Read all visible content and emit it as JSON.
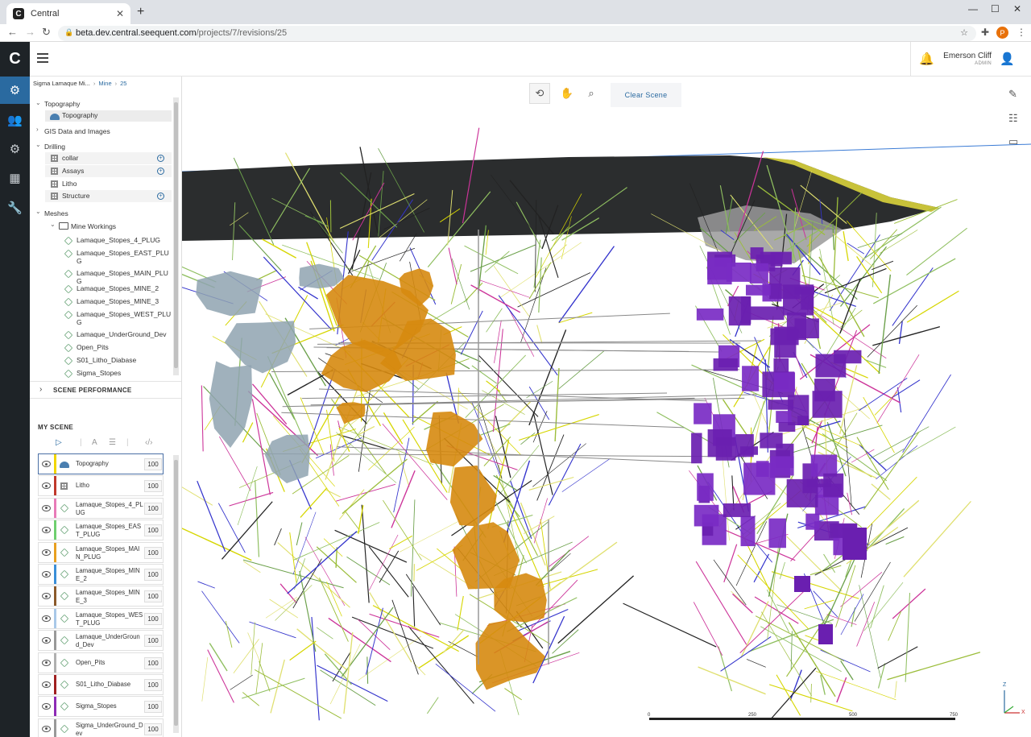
{
  "browser": {
    "tab_title": "Central",
    "url_host": "beta.dev.central.seequent.com",
    "url_path": "/projects/7/revisions/25",
    "profile_initial": "P"
  },
  "app": {
    "logo": "C",
    "user": {
      "name": "Emerson Cliff",
      "role": "ADMIN"
    },
    "rail_icons": [
      "projects-icon",
      "users-icon",
      "settings-icon",
      "calendar-icon",
      "tools-icon"
    ]
  },
  "breadcrumb": {
    "project": "Sigma Lamaque Mi...",
    "folder": "Mine",
    "revision": "25"
  },
  "tree": {
    "topography": {
      "label": "Topography",
      "child": "Topography"
    },
    "gis": {
      "label": "GIS Data and Images"
    },
    "drilling": {
      "label": "Drilling",
      "items": [
        "collar",
        "Assays",
        "Litho",
        "Structure"
      ]
    },
    "meshes": {
      "label": "Meshes",
      "folder": "Mine Workings",
      "items": [
        {
          "l1": "Lamaque_Stopes_4_PLUG",
          "l2": ""
        },
        {
          "l1": "Lamaque_Stopes_EAST_PLU",
          "l2": "G"
        },
        {
          "l1": "Lamaque_Stopes_MAIN_PLU",
          "l2": "G"
        },
        {
          "l1": "Lamaque_Stopes_MINE_2",
          "l2": ""
        },
        {
          "l1": "Lamaque_Stopes_MINE_3",
          "l2": ""
        },
        {
          "l1": "Lamaque_Stopes_WEST_PLU",
          "l2": "G"
        },
        {
          "l1": "Lamaque_UnderGround_Dev",
          "l2": ""
        },
        {
          "l1": "Open_Pits",
          "l2": ""
        },
        {
          "l1": "S01_Litho_Diabase",
          "l2": ""
        },
        {
          "l1": "Sigma_Stopes",
          "l2": ""
        }
      ]
    }
  },
  "scene_performance": {
    "label": "SCENE PERFORMANCE"
  },
  "my_scene": {
    "title": "MY SCENE",
    "items": [
      {
        "label": "Topography",
        "value": "100",
        "color": "#f2d600",
        "icon": "topography-icon"
      },
      {
        "label": "Litho",
        "value": "100",
        "color": "#c0392b",
        "icon": "table-icon"
      },
      {
        "label": "Lamaque_Stopes_4_PLUG",
        "value": "100",
        "color": "#e87bb8",
        "icon": "mesh-icon"
      },
      {
        "label": "Lamaque_Stopes_EAST_PLUG",
        "value": "100",
        "color": "#6fcf6f",
        "icon": "mesh-icon"
      },
      {
        "label": "Lamaque_Stopes_MAIN_PLUG",
        "value": "100",
        "color": "#e8a020",
        "icon": "mesh-icon"
      },
      {
        "label": "Lamaque_Stopes_MINE_2",
        "value": "100",
        "color": "#3b8fd8",
        "icon": "mesh-icon"
      },
      {
        "label": "Lamaque_Stopes_MINE_3",
        "value": "100",
        "color": "#8b5a2b",
        "icon": "mesh-icon"
      },
      {
        "label": "Lamaque_Stopes_WEST_PLUG",
        "value": "100",
        "color": "#a9c8e8",
        "icon": "mesh-icon"
      },
      {
        "label": "Lamaque_UnderGround_Dev",
        "value": "100",
        "color": "#999999",
        "icon": "mesh-icon"
      },
      {
        "label": "Open_Pits",
        "value": "100",
        "color": "#b0b0b0",
        "icon": "mesh-icon"
      },
      {
        "label": "S01_Litho_Diabase",
        "value": "100",
        "color": "#a02020",
        "icon": "mesh-icon"
      },
      {
        "label": "Sigma_Stopes",
        "value": "100",
        "color": "#8e2bb5",
        "icon": "mesh-icon"
      },
      {
        "label": "Sigma_UnderGround_Dev",
        "value": "100",
        "color": "#999999",
        "icon": "mesh-icon"
      }
    ]
  },
  "viewport": {
    "clear_scene": "Clear Scene",
    "scale_ticks": [
      "0",
      "250",
      "500",
      "750"
    ],
    "axis_labels": {
      "z": "Z",
      "x": "X"
    }
  }
}
